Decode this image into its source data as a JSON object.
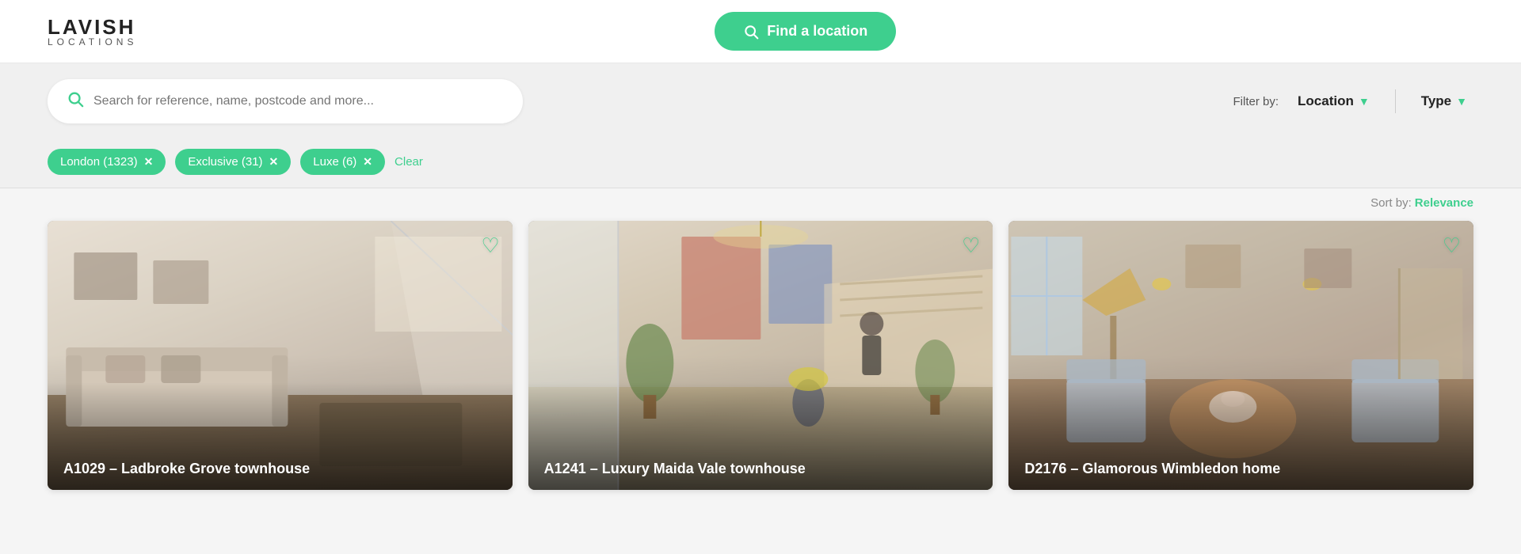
{
  "header": {
    "logo_top": "LAVISH",
    "logo_bottom": "LOCATIONS",
    "find_location_label": "Find a location"
  },
  "search": {
    "placeholder": "Search for reference, name, postcode and more...",
    "filter_label": "Filter by:",
    "location_filter": "Location",
    "type_filter": "Type"
  },
  "tags": [
    {
      "label": "London (1323)",
      "id": "london-tag"
    },
    {
      "label": "Exclusive (31)",
      "id": "exclusive-tag"
    },
    {
      "label": "Luxe (6)",
      "id": "luxe-tag"
    }
  ],
  "clear_label": "Clear",
  "sort": {
    "label": "Sort by:",
    "value": "Relevance"
  },
  "cards": [
    {
      "id": "card-1",
      "title": "A1029 – Ladbroke Grove townhouse"
    },
    {
      "id": "card-2",
      "title": "A1241 – Luxury Maida Vale townhouse"
    },
    {
      "id": "card-3",
      "title": "D2176 – Glamorous Wimbledon home"
    }
  ]
}
